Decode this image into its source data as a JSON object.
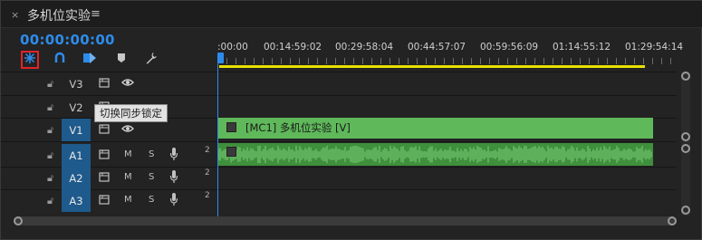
{
  "tab": {
    "close": "×",
    "title": "多机位实验",
    "menu": "≡"
  },
  "timecode": "00:00:00:00",
  "tools": [
    {
      "name": "linked-selection-icon",
      "glyph": "⁂",
      "highlighted": true
    },
    {
      "name": "snap-icon",
      "glyph": "∩",
      "highlighted": false
    },
    {
      "name": "add-edit-icon",
      "glyph": "◪",
      "highlighted": false
    },
    {
      "name": "marker-icon",
      "glyph": "⬟",
      "highlighted": false
    },
    {
      "name": "wrench-icon",
      "glyph": "🔧",
      "highlighted": false
    }
  ],
  "ruler": {
    "labels": [
      ":00:00",
      "00:14:59:02",
      "00:29:58:04",
      "00:44:57:07",
      "00:59:56:09",
      "01:14:55:12",
      "01:29:54:14"
    ]
  },
  "tracks": {
    "video": [
      {
        "name": "V3",
        "target": false
      },
      {
        "name": "V2",
        "target": false
      },
      {
        "name": "V1",
        "target": true
      }
    ],
    "audio": [
      {
        "name": "A1",
        "target": true,
        "mute": "M",
        "solo": "S",
        "channels": "2"
      },
      {
        "name": "A2",
        "target": true,
        "mute": "M",
        "solo": "S",
        "channels": "2"
      },
      {
        "name": "A3",
        "target": true,
        "mute": "M",
        "solo": "S",
        "channels": "2"
      }
    ]
  },
  "tooltip": "切换同步锁定",
  "clips": {
    "video_label": "[MC1] 多机位实验 [V]"
  },
  "colors": {
    "accent": "#2d8ceb",
    "video_clip": "#5fb85a",
    "audio_clip": "#3f8f3c",
    "work_area": "#e8e000",
    "highlight_box": "#e0242a"
  }
}
